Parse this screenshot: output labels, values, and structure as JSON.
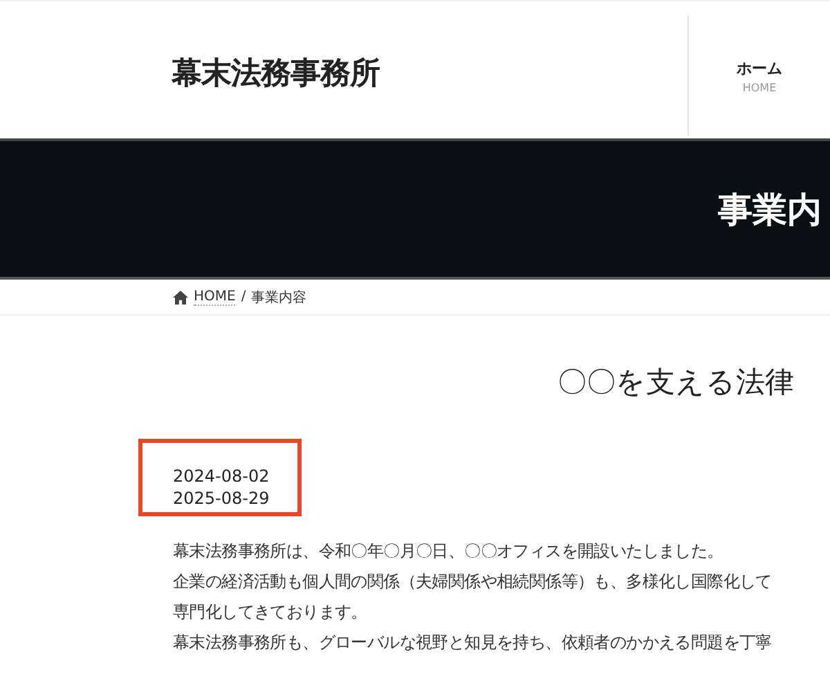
{
  "header": {
    "logo": "幕末法務事務所",
    "nav": [
      {
        "label": "ホーム",
        "sublabel": "HOME"
      }
    ]
  },
  "banner": {
    "title": "事業内"
  },
  "breadcrumb_separator": "/",
  "breadcrumb": [
    {
      "label": "HOME",
      "kind": "home"
    },
    {
      "label": "事業内容",
      "kind": "current"
    }
  ],
  "heading": "〇〇を支える法律",
  "dates": [
    "2024-08-02",
    "2025-08-29"
  ],
  "paragraph_lines": [
    "幕末法務事務所は、令和〇年〇月〇日、〇〇オフィスを開設いたしました。",
    "企業の経済活動も個人間の関係（夫婦関係や相続関係等）も、多様化し国際化して",
    "専門化してきております。",
    "幕末法務事務所も、グローバルな視野と知見を持ち、依頼者のかかえる問題を丁寧"
  ]
}
